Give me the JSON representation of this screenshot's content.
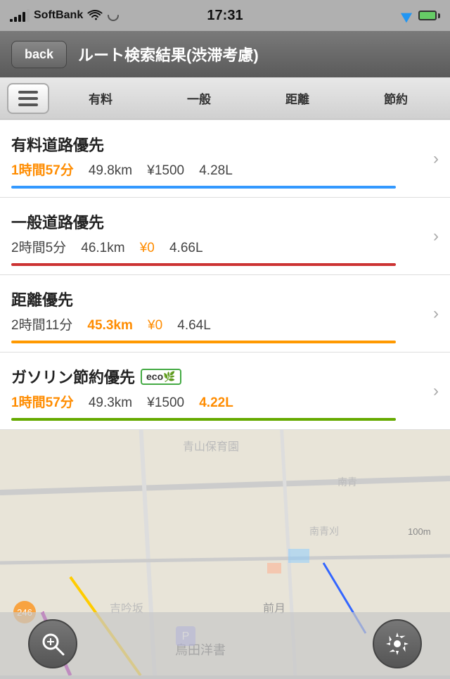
{
  "statusBar": {
    "carrier": "SoftBank",
    "time": "17:31",
    "signal": [
      3,
      6,
      9,
      12,
      15
    ],
    "wifi": "wifi"
  },
  "navBar": {
    "backLabel": "back",
    "title": "ルート検索結果(渋滞考慮)"
  },
  "toolbar": {
    "tabs": [
      {
        "id": "list",
        "label": "≡",
        "active": true
      },
      {
        "id": "tolled",
        "label": "有料",
        "active": false
      },
      {
        "id": "normal",
        "label": "一般",
        "active": false
      },
      {
        "id": "distance",
        "label": "距離",
        "active": false
      },
      {
        "id": "save",
        "label": "節約",
        "active": false
      }
    ]
  },
  "routes": [
    {
      "id": "toll",
      "title": "有料道路優先",
      "time": "1時間57分",
      "distance": "49.8km",
      "cost": "¥1500",
      "fuel": "4.28L",
      "barColor": "bar-blue",
      "timeOrange": true,
      "costOrange": false,
      "eco": false
    },
    {
      "id": "normal",
      "title": "一般道路優先",
      "time": "2時間5分",
      "distance": "46.1km",
      "cost": "¥0",
      "fuel": "4.66L",
      "barColor": "bar-red",
      "timeOrange": false,
      "costOrange": true,
      "eco": false
    },
    {
      "id": "distance",
      "title": "距離優先",
      "time": "2時間11分",
      "distance": "45.3km",
      "cost": "¥0",
      "fuel": "4.64L",
      "barColor": "bar-orange",
      "timeOrange": false,
      "costOrange": true,
      "eco": false
    },
    {
      "id": "eco",
      "title": "ガソリン節約優先",
      "time": "1時間57分",
      "distance": "49.3km",
      "cost": "¥1500",
      "fuel": "4.22L",
      "barColor": "bar-green",
      "timeOrange": true,
      "costOrange": false,
      "eco": true
    }
  ],
  "bottomBar": {
    "searchIcon": "🔍",
    "settingsIcon": "🔧"
  },
  "icons": {
    "chevron": "›",
    "list": "☰"
  }
}
